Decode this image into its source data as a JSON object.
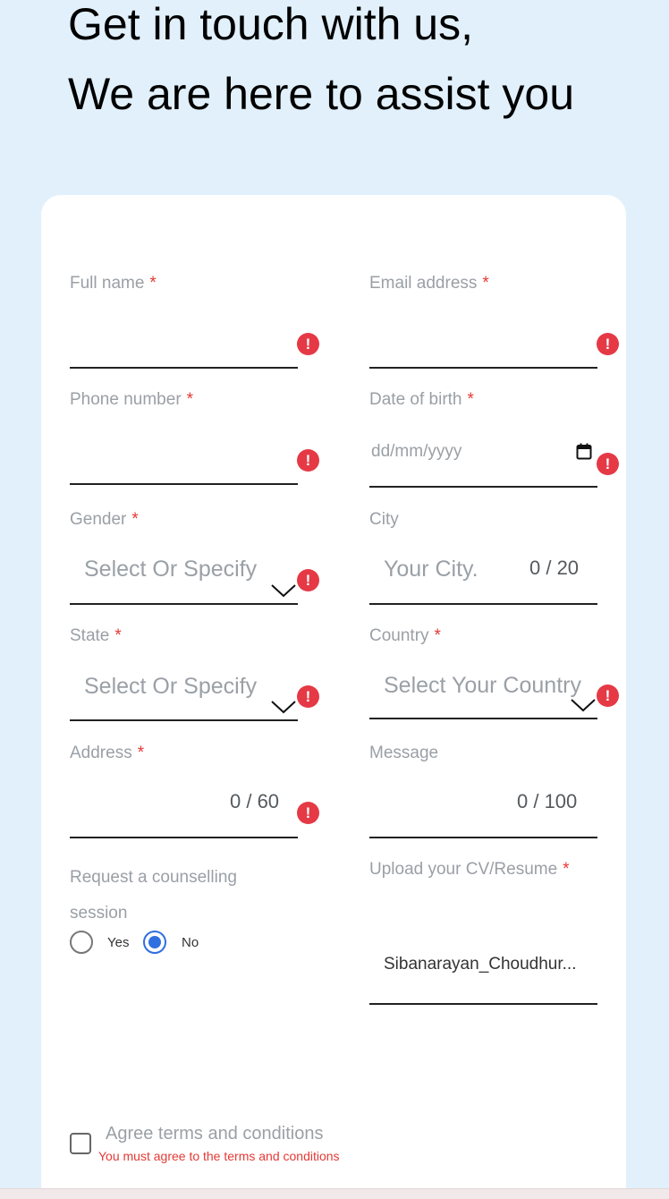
{
  "header": {
    "line1": "Get in touch with us,",
    "line2": "We are here to assist you"
  },
  "form": {
    "full_name": {
      "label": "Full name",
      "required": "*"
    },
    "email": {
      "label": "Email address",
      "required": "*"
    },
    "phone": {
      "label": "Phone number",
      "required": "*"
    },
    "dob": {
      "label": "Date of birth",
      "required": "*",
      "placeholder": "dd/mm/yyyy"
    },
    "gender": {
      "label": "Gender",
      "required": "*",
      "placeholder": "Select Or Specify"
    },
    "city": {
      "label": "City",
      "placeholder": "Your City.",
      "counter": "0 / 20"
    },
    "state": {
      "label": "State",
      "required": "*",
      "placeholder": "Select Or Specify"
    },
    "country": {
      "label": "Country",
      "required": "*",
      "placeholder": "Select Your Country"
    },
    "address": {
      "label": "Address",
      "required": "*",
      "counter": "0 / 60"
    },
    "message": {
      "label": "Message",
      "counter": "0 / 100"
    },
    "counselling": {
      "label_line1": "Request a counselling",
      "label_line2": "session",
      "options": [
        {
          "label": "Yes",
          "selected": false
        },
        {
          "label": "No",
          "selected": true
        }
      ]
    },
    "upload": {
      "label": "Upload your CV/Resume",
      "required": "*",
      "filename": "Sibanarayan_Choudhur..."
    },
    "terms": {
      "label": "Agree terms and conditions",
      "error": "You must agree to the terms and conditions",
      "checked": false
    },
    "error_icon": "!"
  },
  "colors": {
    "page_bg": "#e1f0fb",
    "card_bg": "#ffffff",
    "error": "#e53945",
    "accent": "#2f6fe0"
  }
}
